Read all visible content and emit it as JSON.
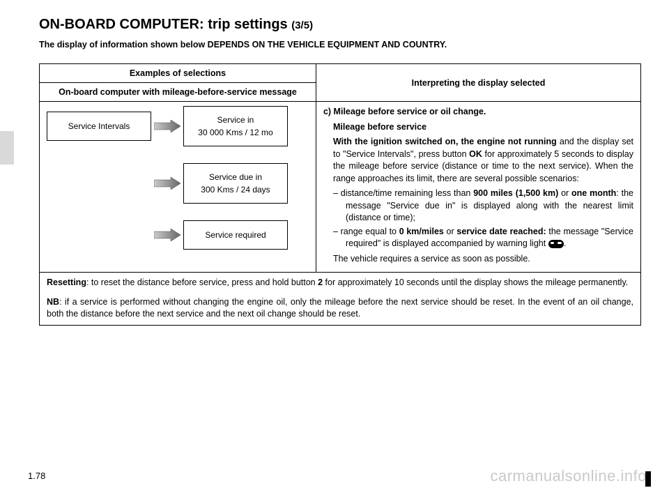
{
  "title_main": "ON-BOARD COMPUTER: trip settings ",
  "title_sub": "(3/5)",
  "subhead": "The display of information shown below DEPENDS ON THE VEHICLE EQUIPMENT AND COUNTRY.",
  "table": {
    "header_left": "Examples of selections",
    "header_left_sub": "On-board computer with mileage-before-service message",
    "header_right": "Interpreting the display selected",
    "boxes": {
      "service_intervals": "Service Intervals",
      "service_in_line1": "Service in",
      "service_in_line2": "30 000 Kms / 12 mo",
      "service_due_line1": "Service due in",
      "service_due_line2": "300 Kms / 24 days",
      "service_required": "Service required"
    },
    "right": {
      "heading": "c) Mileage before service or oil change.",
      "sub1_bold": "Mileage before service",
      "sub2_bold": "With the ignition switched on, the engine not running",
      "sub2_rest": " and the display set to \"Service Intervals\", press button ",
      "ok": "OK",
      "sub2_rest2": " for approximately 5 seconds to display the mileage before service (distance or time to the next service). When the range approaches its limit, there are several possible scenarios:",
      "li1_a": "distance/time remaining less than ",
      "li1_b1": "900 miles (1,500 km)",
      "li1_b2": " or ",
      "li1_b3": "one month",
      "li1_c": ": the message \"Service due in\" is displayed along with the nearest limit (distance or time);",
      "li2_a": "range equal to ",
      "li2_b1": "0 km/miles",
      "li2_b2": " or ",
      "li2_b3": "service date reached:",
      "li2_c": " the message \"Service required\" is displayed accompanied by warning light ",
      "li2_d": ".",
      "tail": "The vehicle requires a service as soon as possible."
    },
    "footer": {
      "p1_bold": "Resetting",
      "p1_a": ": to reset the distance before service, press and hold button ",
      "p1_num": "2",
      "p1_b": " for approximately 10 seconds until the display shows the mileage permanently.",
      "p2_bold": "NB",
      "p2_a": ": if a service is performed without changing the engine oil, only the mileage before the next service should be reset. In the event of an oil change, both the distance before the next service and the next oil change should be reset."
    }
  },
  "page_num": "1.78",
  "watermark": "carmanualsonline.info"
}
